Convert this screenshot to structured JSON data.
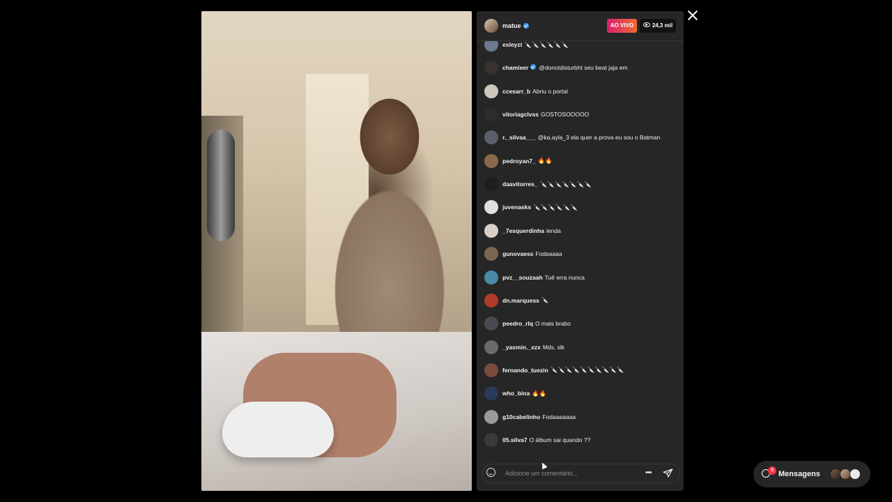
{
  "stream": {
    "username": "matue",
    "live_label": "AO VIVO",
    "viewers": "24,3 mil"
  },
  "comments": [
    {
      "user": "esleyzt",
      "text": "🔪🔪🔪🔪🔪🔪",
      "color": "#6b7a8c",
      "verified": false
    },
    {
      "user": "chamieer",
      "text": "@donotdisturbht seu beat jaja em",
      "color": "#3a3030",
      "verified": true
    },
    {
      "user": "ccesarr_b",
      "text": "Abriu o portal",
      "color": "#cfc7bd",
      "verified": false
    },
    {
      "user": "vitoriagclvss",
      "text": "GOSTOSOOOOO",
      "color": "#2c2c2c",
      "verified": false
    },
    {
      "user": "r._silvaa___",
      "text": "@ka.ayla_3 ela quer a prova eu sou o Batman",
      "color": "#5a5f6a",
      "verified": false
    },
    {
      "user": "pedroyan7_",
      "text": "🔥🔥",
      "color": "#8a6a4a",
      "verified": false
    },
    {
      "user": "daavitorres_",
      "text": "🔪🔪🔪🔪🔪🔪🔪",
      "color": "#1e1e1e",
      "verified": false
    },
    {
      "user": "juvenasks",
      "text": "🔪🔪🔪🔪🔪🔪",
      "color": "#e0e0e0",
      "verified": false
    },
    {
      "user": "_7esquerdinha",
      "text": "lenda",
      "color": "#d8d0c8",
      "verified": false
    },
    {
      "user": "gunovaess",
      "text": "Fodaaaaa",
      "color": "#7a6650",
      "verified": false
    },
    {
      "user": "pvz__souzaah",
      "text": "Tuê erra nunca",
      "color": "#4a8aa8",
      "verified": false
    },
    {
      "user": "dn.marquess",
      "text": "🔪",
      "color": "#b03a2a",
      "verified": false
    },
    {
      "user": "peedro_rlq",
      "text": "O mais brabo",
      "color": "#4a4a55",
      "verified": false
    },
    {
      "user": "_yasmin._xzx",
      "text": "Mds, slk",
      "color": "#6a6a6a",
      "verified": false
    },
    {
      "user": "fernando_tuezin",
      "text": "🔪🔪🔪🔪🔪🔪🔪🔪🔪🔪",
      "color": "#7a4a3a",
      "verified": false
    },
    {
      "user": "who_bina",
      "text": "🔥🔥",
      "color": "#2a3a5a",
      "verified": false
    },
    {
      "user": "g10cabelinho",
      "text": "Fodaaaaaaa",
      "color": "#9a9a9a",
      "verified": false
    },
    {
      "user": "05.silva7",
      "text": "O álbum sai quando ??",
      "color": "#3a3a3a",
      "verified": false
    }
  ],
  "composer": {
    "placeholder": "Adicione um comentário...",
    "more_label": "•••"
  },
  "messages": {
    "label": "Mensagens",
    "badge": "3"
  },
  "icons": {
    "close": "close-icon",
    "smile": "smile-icon",
    "send": "send-icon",
    "more": "more-icon",
    "messages": "messenger-icon",
    "eye": "eye-icon",
    "verified": "verified-icon"
  }
}
